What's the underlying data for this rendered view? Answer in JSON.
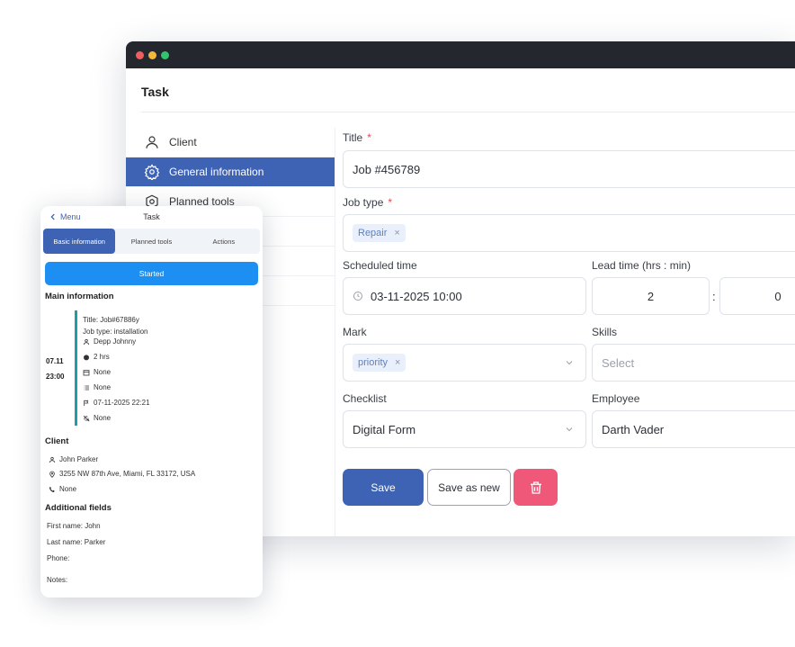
{
  "window": {
    "title": "Task",
    "sidebar": [
      {
        "label": "Client",
        "icon": "user-icon",
        "active": false
      },
      {
        "label": "General information",
        "icon": "gear-icon",
        "active": true
      },
      {
        "label": "Planned tools",
        "icon": "tools-icon",
        "active": false
      }
    ],
    "form": {
      "title_label": "Title",
      "title_value": "Job #456789",
      "job_type_label": "Job type",
      "job_type_tag": "Repair",
      "scheduled_label": "Scheduled time",
      "scheduled_value": "03-11-2025 10:00",
      "lead_label": "Lead time (hrs : min)",
      "lead_hours": "2",
      "lead_separator": ":",
      "lead_minutes": "0",
      "mark_label": "Mark",
      "mark_tag": "priority",
      "skills_label": "Skills",
      "skills_placeholder": "Select",
      "checklist_label": "Checklist",
      "checklist_value": "Digital Form",
      "employee_label": "Employee",
      "employee_value": "Darth Vader",
      "required_mark": "*",
      "tag_remove": "×"
    },
    "buttons": {
      "save": "Save",
      "save_as_new": "Save as new"
    }
  },
  "mobile": {
    "back_label": "Menu",
    "title": "Task",
    "tabs": [
      "Basic information",
      "Planned tools",
      "Actions"
    ],
    "status": "Started",
    "main_heading": "Main information",
    "date": "07.11",
    "time": "23:00",
    "job_title": "Title: Job#67886y",
    "job_type": "Job type: installation",
    "assignee": "Depp Johnny",
    "duration": "2 hrs",
    "calendar": "None",
    "list": "None",
    "flag_date": "07-11-2025 22:21",
    "mute": "None",
    "client_heading": "Client",
    "client_name": "John Parker",
    "client_address": "3255 NW 87th Ave, Miami, FL 33172, USA",
    "client_phone": "None",
    "additional_heading": "Additional fields",
    "first_name": "First name: John",
    "last_name": "Last name: Parker",
    "phone": "Phone:",
    "notes": "Notes:"
  },
  "colors": {
    "primary": "#3f63b4",
    "status": "#1d8ff2",
    "danger": "#f0587a",
    "accent_bar": "#1a9fa8"
  }
}
